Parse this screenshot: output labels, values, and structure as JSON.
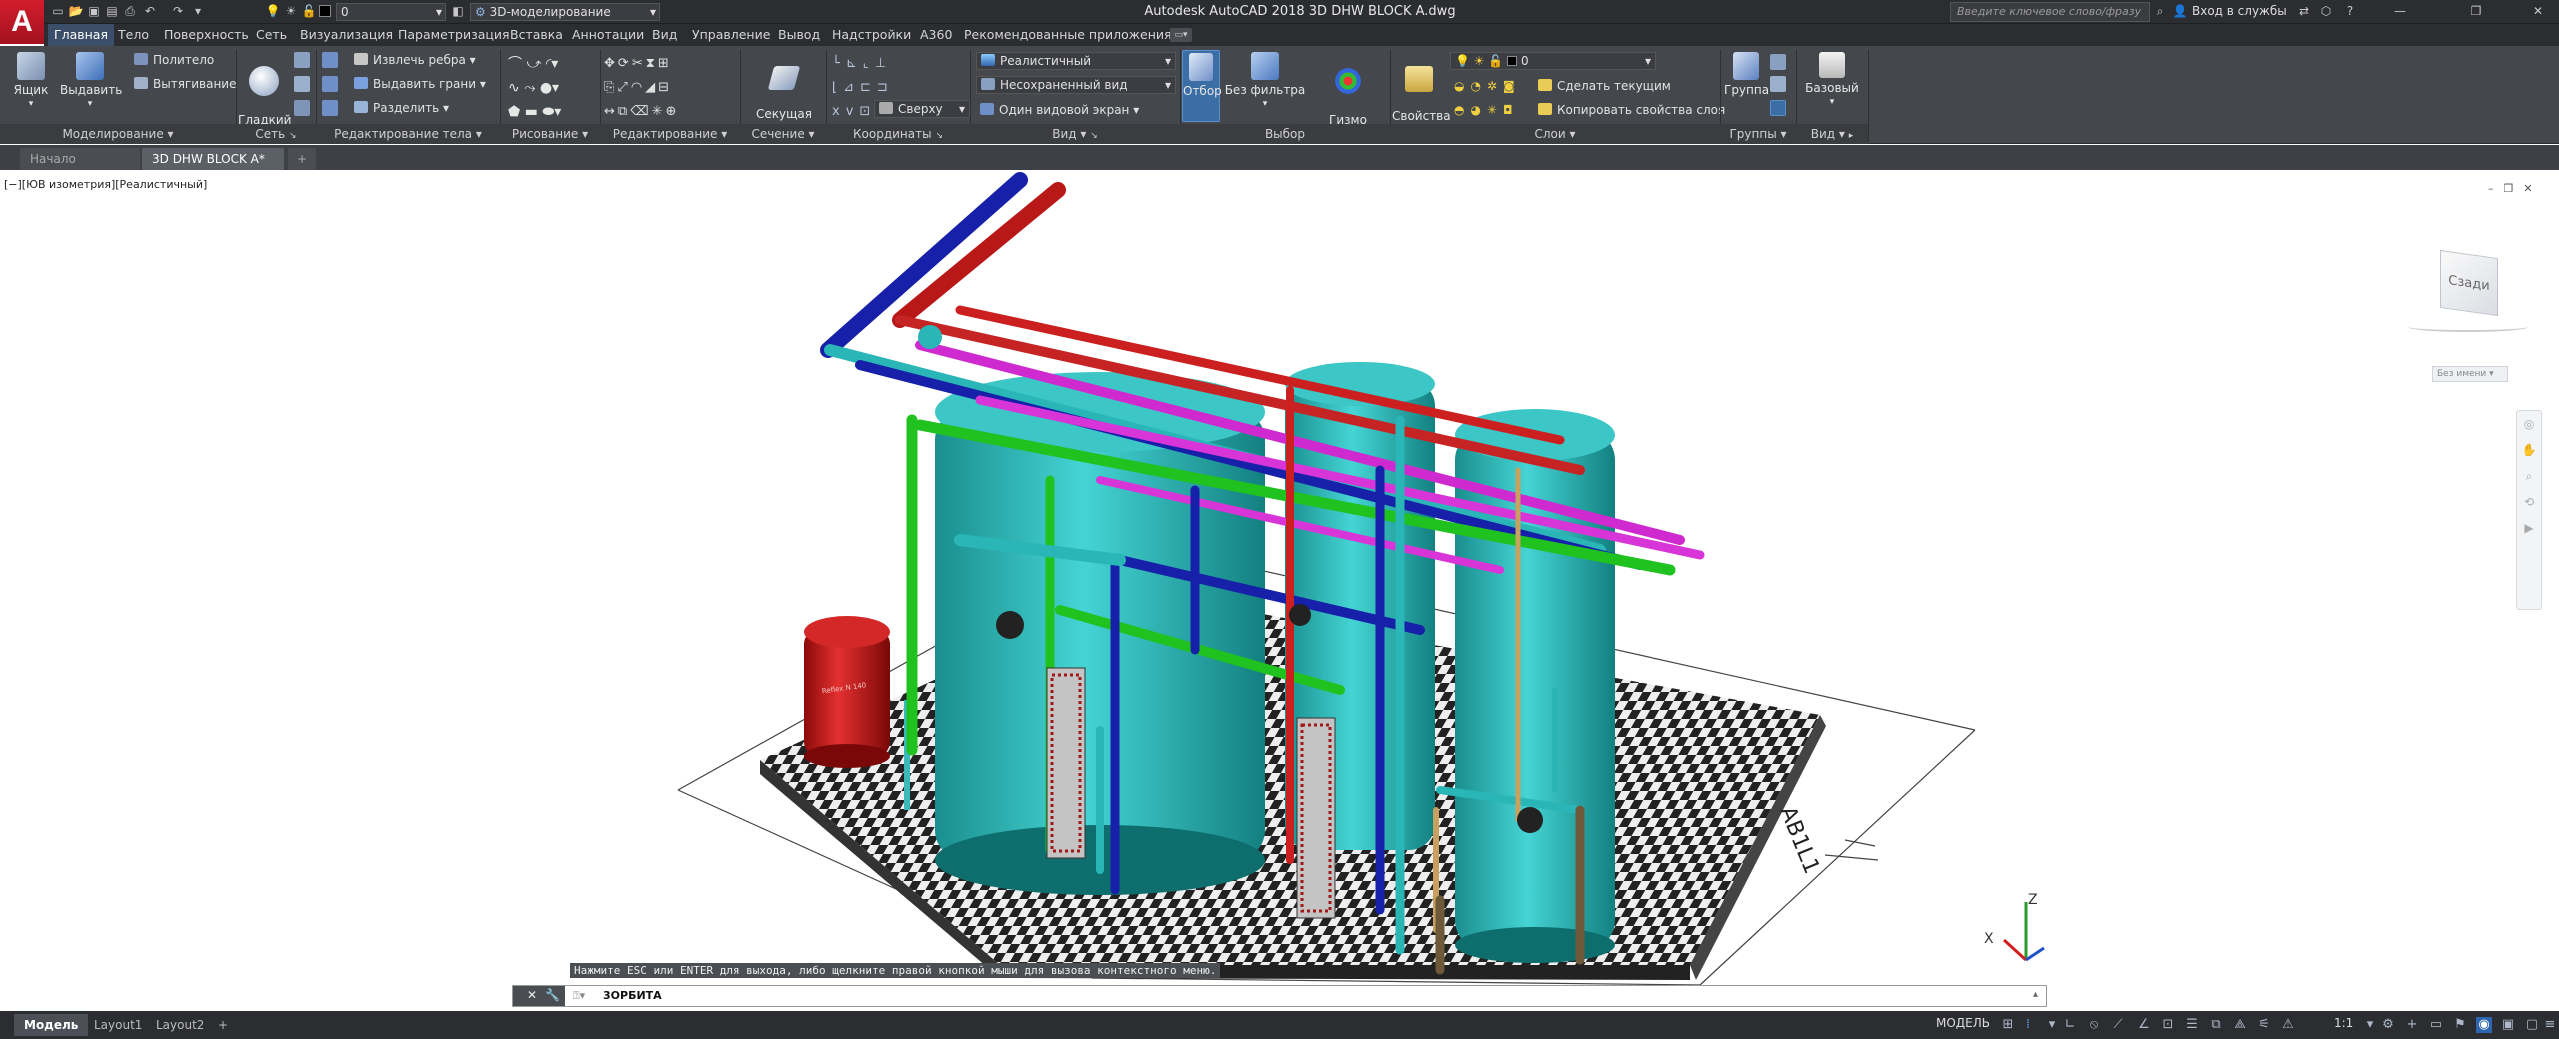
{
  "app": {
    "logo": "A",
    "title": "Autodesk AutoCAD 2018    3D DHW BLOCK A.dwg"
  },
  "quick_access": {
    "layer_value": "0",
    "workspace": "3D-моделирование"
  },
  "search": {
    "placeholder": "Введите ключевое слово/фразу"
  },
  "account": {
    "signin": "Вход в службы"
  },
  "ribbon_tabs": [
    "Главная",
    "Тело",
    "Поверхность",
    "Сеть",
    "Визуализация",
    "Параметризация",
    "Вставка",
    "Аннотации",
    "Вид",
    "Управление",
    "Вывод",
    "Надстройки",
    "A360",
    "Рекомендованные приложения"
  ],
  "ribbon": {
    "box": "Ящик",
    "extrude": "Выдавить",
    "polysolid": "Политело",
    "presspull": "Вытягивание",
    "smooth": "Гладкий\nобъект",
    "extract_edges": "Извлечь ребра",
    "extrude_faces": "Выдавить грани",
    "separate": "Разделить",
    "section_plane": "Секущая\nплоскость",
    "visual_style": "Реалистичный",
    "view_name": "Несохраненный вид",
    "view_dir": "Сверху",
    "single_viewport": "Один видовой экран",
    "culling": "Отбор",
    "no_filter": "Без фильтра",
    "gizmo": "Гизмо\nпереноса",
    "layer_props": "Свойства\nслоя",
    "layer_current": "0",
    "make_current": "Сделать текущим",
    "match_layer": "Копировать свойства слоя",
    "group": "Группа",
    "base": "Базовый",
    "panels": {
      "modeling": "Моделирование ▾",
      "mesh": "Сеть",
      "solid_edit": "Редактирование тела ▾",
      "draw": "Рисование ▾",
      "modify": "Редактирование ▾",
      "section": "Сечение ▾",
      "coordinates": "Координаты",
      "view": "Вид ▾",
      "selection": "Выбор",
      "layers": "Слои ▾",
      "groups": "Группы ▾",
      "view2": "Вид ▾"
    }
  },
  "doc_tabs": {
    "start": "Начало",
    "drawing": "3D DHW BLOCK A*",
    "new": "+"
  },
  "viewport": {
    "label": "[−][ЮВ изометрия][Реалистичный]",
    "viewcube_face": "Сзади",
    "wcs": "Без имени",
    "dimension_text": "AB1L1",
    "axes": {
      "x": "X",
      "z": "Z"
    },
    "tank_label": "Reflex N 140"
  },
  "command": {
    "history": "Нажмите ESC или ENTER для выхода, либо щелкните правой кнопкой мыши для вызова контекстного меню.",
    "prompt": "3ОРБИТА"
  },
  "status": {
    "tabs": [
      "Модель",
      "Layout1",
      "Layout2"
    ],
    "model_label": "МОДЕЛЬ",
    "scale": "1:1"
  },
  "colors": {
    "accent": "#3b8fe0",
    "cyan": "#27b7b7",
    "magenta": "#d62fd6",
    "red": "#cc2020",
    "blue": "#1515b0",
    "green": "#22c322"
  }
}
